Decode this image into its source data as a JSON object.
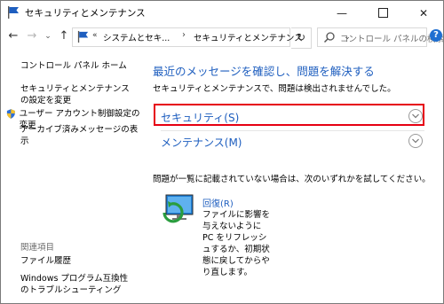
{
  "window": {
    "title": "セキュリティとメンテナンス",
    "min_glyph": "—",
    "close_glyph": "✕"
  },
  "nav": {
    "back_glyph": "←",
    "forward_glyph": "→",
    "recent_glyph": "⌄",
    "up_glyph": "↑",
    "refresh_glyph": "↻",
    "address_chevron": "«",
    "breadcrumb": [
      "システムとセキ...",
      "セキュリティとメンテナンス"
    ],
    "breadcrumb_sep": "›",
    "address_dropdown_glyph": "⌄",
    "search_placeholder": "コントロール パネルの検索",
    "help_glyph": "?"
  },
  "sidebar": {
    "home": "コントロール パネル ホーム",
    "settings_change": "セキュリティとメンテナンスの設定を変更",
    "uac": "ユーザー アカウント制御設定の変更",
    "archive": "アーカイブ済みメッセージの表示",
    "related_heading": "関連項目",
    "file_history": "ファイル履歴",
    "compat": "Windows プログラム互換性のトラブルシューティング"
  },
  "main": {
    "heading": "最近のメッセージを確認し、問題を解決する",
    "subtext": "セキュリティとメンテナンスで、問題は検出されませんでした。",
    "security_label": "セキュリティ(S)",
    "maintenance_label": "メンテナンス(M)",
    "note": "問題が一覧に記載されていない場合は、次のいずれかを試してください。",
    "recovery_title": "回復(R)",
    "recovery_desc": "ファイルに影響を与えないように PC をリフレッシュするか、初期状態に戻してからやり直します。"
  },
  "colors": {
    "link": "#1e5ebf",
    "highlight": "#e60012",
    "help": "#1f6fd1"
  },
  "icons": {
    "title": "flag-icon",
    "address": "flag-icon",
    "uac": "shield-icon",
    "recovery": "recovery-icon",
    "search": "search-icon",
    "expand": "chevron-down-icon"
  }
}
